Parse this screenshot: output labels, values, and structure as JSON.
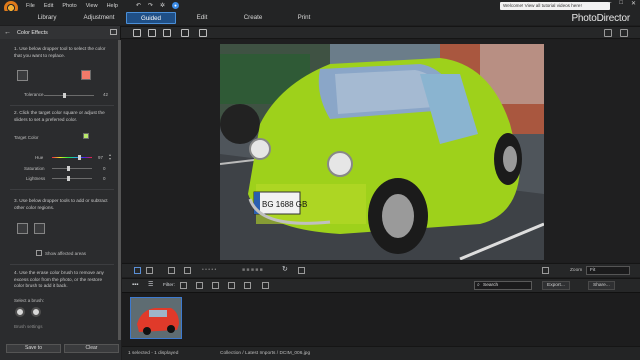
{
  "menu": {
    "items": [
      "File",
      "Edit",
      "Photo",
      "View",
      "Help"
    ],
    "notification": "Welcome! View all tutorial videos here!"
  },
  "tabs": [
    "Library",
    "Adjustment",
    "Guided",
    "Edit",
    "Create",
    "Print"
  ],
  "active_tab": "Guided",
  "brand": "PhotoDirector",
  "panel": {
    "title": "Color Effects",
    "step1": "1. Use below dropper tool to select the color that you want to replace.",
    "tolerance_label": "Tolerance",
    "tolerance_value": "42",
    "step2": "2. Click the target color square or adjust the sliders to set a preferred color.",
    "target_color_label": "Target Color",
    "hue_label": "Hue",
    "hue_value": "97",
    "saturation_label": "Saturation",
    "saturation_value": "0",
    "lightness_label": "Lightness",
    "lightness_value": "0",
    "step3": "3. Use below dropper tools to add or subtract other color regions.",
    "show_affected_label": "Show affected areas",
    "step4": "4. Use the erase color brush to remove any excess color from the photo, or the restore color brush to add it back.",
    "select_brush_label": "Select a brush:",
    "brush_settings_label": "Brush settings",
    "save_label": "Save to",
    "clear_label": "Clear",
    "colors": {
      "source": "#f07a6a",
      "target": "#b8e86a"
    }
  },
  "bottom": {
    "filter_label": "Filter:",
    "zoom_label": "Zoom",
    "zoom_value": "Fit",
    "search_placeholder": "Search",
    "export_label": "Export...",
    "share_label": "Share...",
    "status_selected": "1 selected - 1 displayed",
    "status_path": "Collection / Latest Imports / DCIM_006.jpg"
  },
  "photo": {
    "plate": "BG 1688 GB",
    "body_color": "#9ed11b"
  }
}
